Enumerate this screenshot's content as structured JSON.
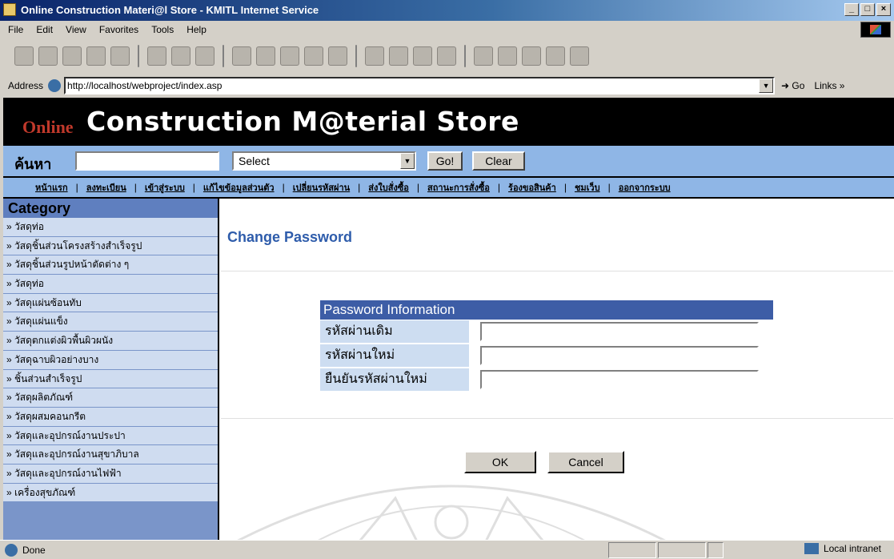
{
  "window": {
    "title": "Online Construction Materi@l Store - KMITL Internet Service"
  },
  "menu": [
    "File",
    "Edit",
    "View",
    "Favorites",
    "Tools",
    "Help"
  ],
  "address": {
    "label": "Address",
    "url": "http://localhost/webproject/index.asp",
    "go": "Go",
    "links": "Links"
  },
  "banner": {
    "prefix": "Online",
    "title": "Construction M@terial Store"
  },
  "search": {
    "label": "ค้นหา",
    "input_value": "",
    "select_value": "Select",
    "go_label": "Go!",
    "clear_label": "Clear"
  },
  "nav": [
    "หน้าแรก",
    "ลงทะเบียน",
    "เข้าสู่ระบบ",
    "แก้ไขข้อมูลส่วนตัว",
    "เปลี่ยนรหัสผ่าน",
    "ส่งใบสั่งซื้อ",
    "สถานะการสั่งซื้อ",
    "ร้องขอสินค้า",
    "ชมเว็บ",
    "ออกจากระบบ"
  ],
  "sidebar": {
    "heading": "Category",
    "items": [
      "» วัสดุท่อ",
      "» วัสดุชิ้นส่วนโครงสร้างสำเร็จรูป",
      "» วัสดุชิ้นส่วนรูปหน้าตัดต่าง ๆ",
      "» วัสดุท่อ",
      "» วัสดุแผ่นซ้อนทับ",
      "» วัสดุแผ่นแข็ง",
      "» วัสดุตกแต่งผิวพื้นผิวผนัง",
      "» วัสดุฉาบผิวอย่างบาง",
      "» ชิ้นส่วนสำเร็จรูป",
      "» วัสดุผลิตภัณฑ์",
      "» วัสดุผสมคอนกรีต",
      "» วัสดุและอุปกรณ์งานประปา",
      "» วัสดุและอุปกรณ์งานสุขาภิบาล",
      "» วัสดุและอุปกรณ์งานไฟฟ้า",
      "» เครื่องสุขภัณฑ์"
    ]
  },
  "main": {
    "title": "Change Password",
    "form": {
      "heading": "Password Information",
      "fields": [
        {
          "label": "รหัสผ่านเดิม",
          "value": ""
        },
        {
          "label": "รหัสผ่านใหม่",
          "value": ""
        },
        {
          "label": "ยืนยันรหัสผ่านใหม่",
          "value": ""
        }
      ],
      "ok_label": "OK",
      "cancel_label": "Cancel"
    }
  },
  "status": {
    "left": "Done",
    "right": "Local intranet"
  }
}
